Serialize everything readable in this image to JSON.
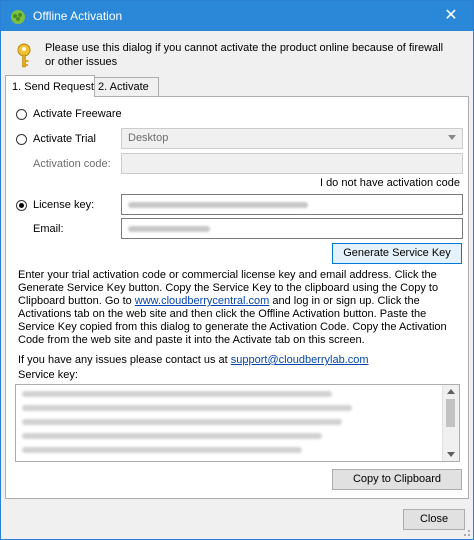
{
  "window": {
    "title": "Offline Activation",
    "close_glyph": "✕"
  },
  "info": {
    "message": "Please use this dialog if you cannot activate the product online because of firewall or other issues"
  },
  "tabs": [
    {
      "label": "1. Send Request",
      "active": true
    },
    {
      "label": "2. Activate",
      "active": false
    }
  ],
  "form": {
    "activate_freeware": "Activate Freeware",
    "activate_trial": "Activate Trial",
    "trial_edition": "Desktop",
    "activation_code_label": "Activation code:",
    "activation_code_value": "",
    "no_code_link": "I do not have activation code",
    "license_key_label": "License key:",
    "email_label": "Email:",
    "generate_button": "Generate Service Key"
  },
  "description": {
    "part1": "Enter your trial activation code or commercial license key and email address. Click the Generate Service Key button. Copy the Service Key to the clipboard using the Copy to Clipboard button. Go to ",
    "link": "www.cloudberrycentral.com",
    "part2": " and log in or sign up. Click the Activations tab on the web site and then click the Offline Activation button. Paste the Service Key copied from this dialog to generate the Activation Code. Copy the Activation Code from the web site and paste it into the Activate tab on this screen.",
    "support_text": "If you have any issues please contact us at ",
    "support_email": "support@cloudberrylab.com"
  },
  "service_key": {
    "label": "Service key:",
    "copy_button": "Copy to Clipboard"
  },
  "footer": {
    "close_button": "Close"
  },
  "icons": {
    "app": "cloudberry-app-icon",
    "key": "key-icon"
  },
  "colors": {
    "titlebar": "#2b88d8",
    "link": "#0645ad",
    "focus": "#0078d7"
  }
}
